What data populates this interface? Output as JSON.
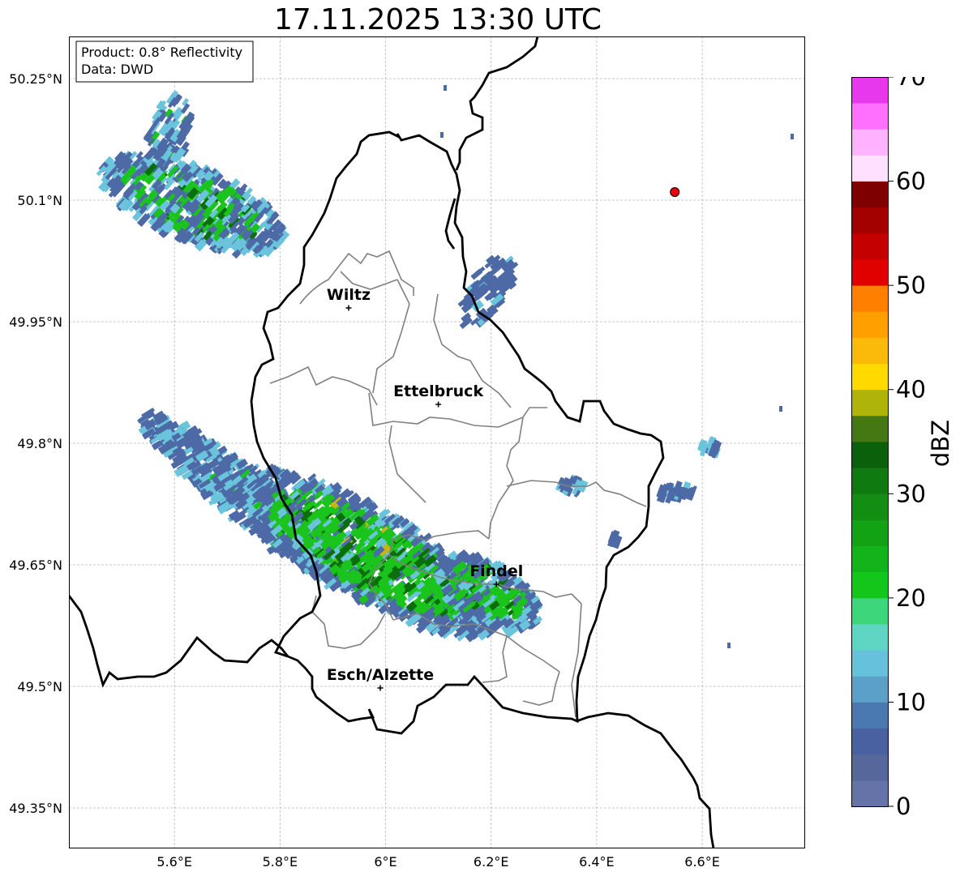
{
  "title": "17.11.2025 13:30 UTC",
  "info_box": {
    "product": "Product: 0.8° Reflectivity",
    "data": "Data: DWD"
  },
  "lat_ticks": [
    {
      "value": 50.25,
      "label": "50.25°N"
    },
    {
      "value": 50.1,
      "label": "50.1°N"
    },
    {
      "value": 49.95,
      "label": "49.95°N"
    },
    {
      "value": 49.8,
      "label": "49.8°N"
    },
    {
      "value": 49.65,
      "label": "49.65°N"
    },
    {
      "value": 49.5,
      "label": "49.5°N"
    },
    {
      "value": 49.35,
      "label": "49.35°N"
    }
  ],
  "lon_ticks": [
    {
      "value": 5.6,
      "label": "5.6°E"
    },
    {
      "value": 5.8,
      "label": "5.8°E"
    },
    {
      "value": 6.0,
      "label": "6°E"
    },
    {
      "value": 6.2,
      "label": "6.2°E"
    },
    {
      "value": 6.4,
      "label": "6.4°E"
    },
    {
      "value": 6.6,
      "label": "6.6°E"
    }
  ],
  "extent": {
    "lon_min": 5.4,
    "lon_max": 6.795,
    "lat_min": 49.3,
    "lat_max": 50.302
  },
  "cities": [
    {
      "name": "Wiltz",
      "lon": 5.93,
      "lat": 49.967
    },
    {
      "name": "Ettelbruck",
      "lon": 6.1,
      "lat": 49.848
    },
    {
      "name": "Findel",
      "lon": 6.21,
      "lat": 49.626
    },
    {
      "name": "Esch/Alzette",
      "lon": 5.99,
      "lat": 49.498
    }
  ],
  "radar_site": {
    "lon": 6.548,
    "lat": 50.11,
    "color": "#e8000b"
  },
  "colorbar": {
    "label": "dBZ",
    "min": 0,
    "max": 70,
    "ticks": [
      "0",
      "10",
      "20",
      "30",
      "40",
      "50",
      "60",
      "70"
    ],
    "colors": [
      "#6573a8",
      "#56679c",
      "#4a61a1",
      "#4a78b0",
      "#5aa0c8",
      "#66c2dc",
      "#5fd6c4",
      "#3ed67a",
      "#14c61a",
      "#12b41a",
      "#12a214",
      "#138e13",
      "#0f7a0f",
      "#0b600b",
      "#457812",
      "#b0b30a",
      "#ffd900",
      "#fbb90a",
      "#ff9f00",
      "#ff7f00",
      "#e10000",
      "#c40000",
      "#a30000",
      "#7f0000",
      "#ffe0ff",
      "#ffb2ff",
      "#ff70ff",
      "#e838ee"
    ]
  },
  "echo_legend": {
    "weak": "#4d6aa6",
    "light": "#6ac4dc",
    "moderate": "#1ac41c",
    "strong": "#0a6e0a",
    "intense": "#c8b418"
  }
}
